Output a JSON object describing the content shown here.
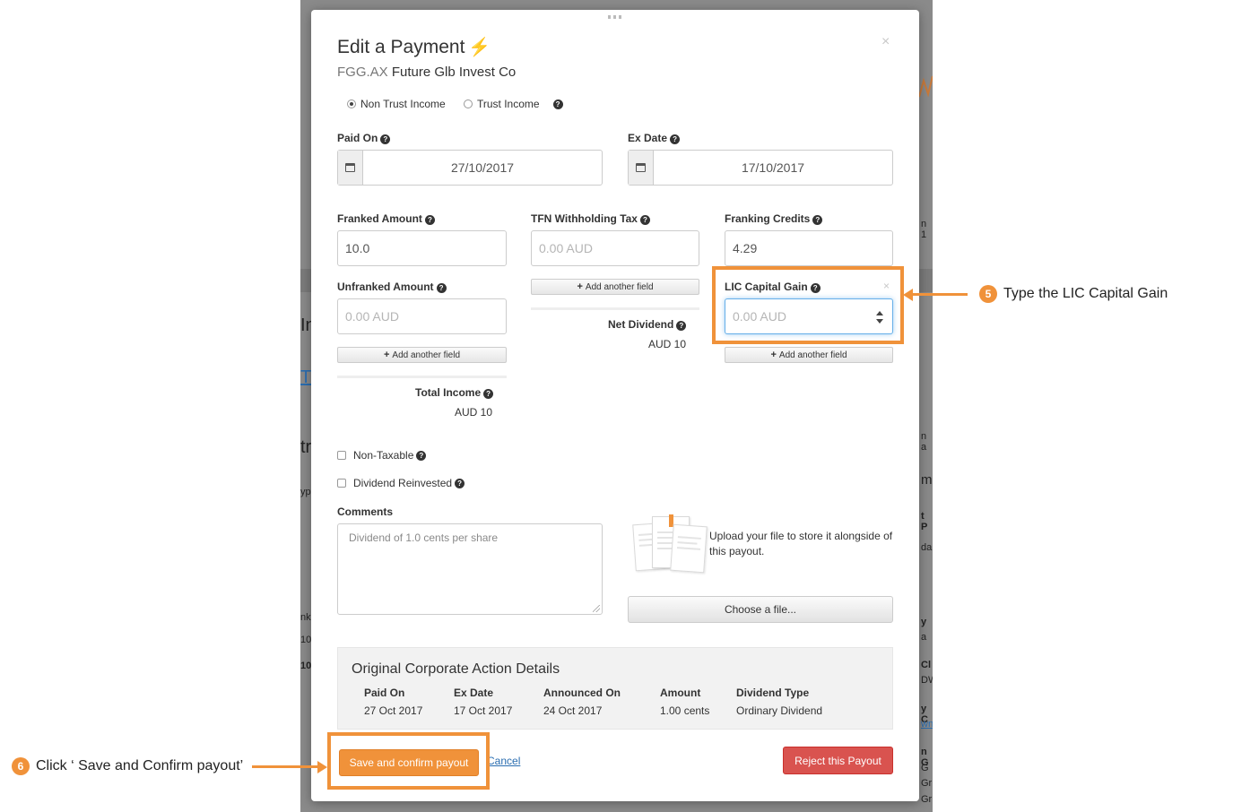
{
  "background": {
    "fragments": [
      "In",
      "TS",
      "tr",
      "yp",
      "nk",
      "10",
      "10",
      "n 1",
      "n a",
      "m",
      "t P",
      "da",
      "y",
      "a",
      "Cl",
      "DW",
      "y C",
      "wn",
      "n G",
      "G",
      "Gr",
      "Gr"
    ]
  },
  "modal": {
    "title": "Edit a Payment",
    "ticker": "FGG.AX",
    "company": "Future Glb Invest Co",
    "close_symbol": "×",
    "income_types": [
      {
        "label": "Non Trust Income",
        "selected": true
      },
      {
        "label": "Trust Income",
        "selected": false
      }
    ],
    "paid_on": {
      "label": "Paid On",
      "value": "27/10/2017"
    },
    "ex_date": {
      "label": "Ex Date",
      "value": "17/10/2017"
    },
    "franked_amount": {
      "label": "Franked Amount",
      "value": "10.0"
    },
    "tfn_withholding_tax": {
      "label": "TFN Withholding Tax",
      "placeholder": "0.00 AUD"
    },
    "franking_credits": {
      "label": "Franking Credits",
      "value": "4.29"
    },
    "unfranked_amount": {
      "label": "Unfranked Amount",
      "placeholder": "0.00 AUD"
    },
    "lic_capital_gain": {
      "label": "LIC Capital Gain",
      "placeholder": "0.00 AUD",
      "remove_symbol": "×"
    },
    "add_field_label": "Add another field",
    "net_dividend": {
      "label": "Net Dividend",
      "value": "AUD 10"
    },
    "total_income": {
      "label": "Total Income",
      "value": "AUD 10"
    },
    "non_taxable": {
      "label": "Non-Taxable",
      "checked": false
    },
    "dividend_reinvested": {
      "label": "Dividend Reinvested",
      "checked": false
    },
    "comments": {
      "label": "Comments",
      "value": "Dividend of 1.0 cents per share"
    },
    "upload_text": "Upload your file to store it alongside of this payout.",
    "choose_file_label": "Choose a file...",
    "original": {
      "title": "Original Corporate Action Details",
      "columns": [
        {
          "header": "Paid On",
          "value": "27 Oct 2017"
        },
        {
          "header": "Ex Date",
          "value": "17 Oct 2017"
        },
        {
          "header": "Announced On",
          "value": "24 Oct 2017"
        },
        {
          "header": "Amount",
          "value": "1.00 cents"
        },
        {
          "header": "Dividend Type",
          "value": "Ordinary Dividend"
        }
      ]
    },
    "save_label": "Save and confirm payout",
    "cancel_label": "Cancel",
    "reject_label": "Reject this Payout"
  },
  "annotations": {
    "step5": {
      "number": "5",
      "text": "Type the LIC Capital Gain"
    },
    "step6": {
      "number": "6",
      "text": "Click ‘ Save and Confirm payout’"
    }
  },
  "colors": {
    "accent": "#f0923a",
    "danger": "#d9534f",
    "link": "#2a6db0"
  }
}
